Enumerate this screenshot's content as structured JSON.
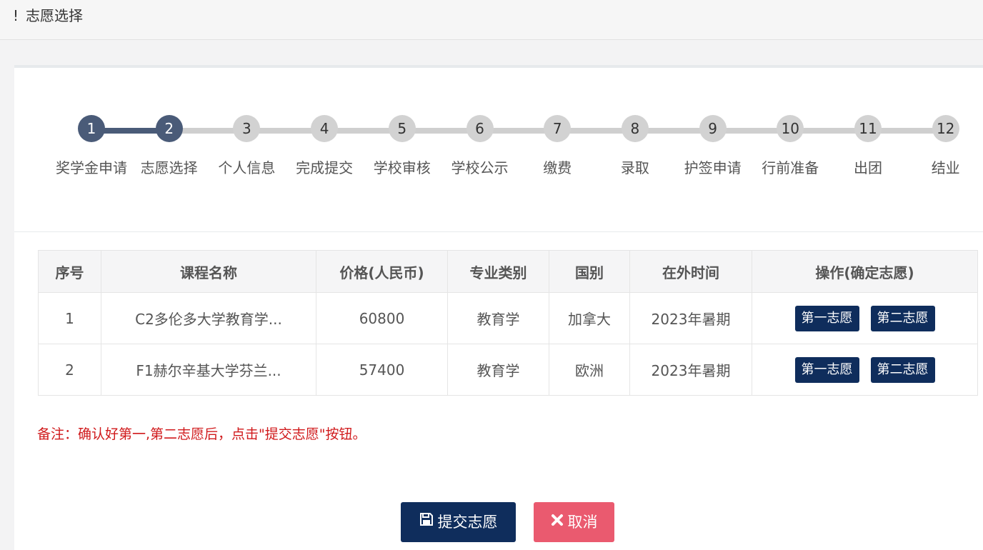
{
  "header": {
    "bang": "!",
    "title": "志愿选择"
  },
  "steps": [
    {
      "num": "1",
      "label": "奖学金申请",
      "done": true
    },
    {
      "num": "2",
      "label": "志愿选择",
      "done": true
    },
    {
      "num": "3",
      "label": "个人信息",
      "done": false
    },
    {
      "num": "4",
      "label": "完成提交",
      "done": false
    },
    {
      "num": "5",
      "label": "学校审核",
      "done": false
    },
    {
      "num": "6",
      "label": "学校公示",
      "done": false
    },
    {
      "num": "7",
      "label": "缴费",
      "done": false
    },
    {
      "num": "8",
      "label": "录取",
      "done": false
    },
    {
      "num": "9",
      "label": "护签申请",
      "done": false
    },
    {
      "num": "10",
      "label": "行前准备",
      "done": false
    },
    {
      "num": "11",
      "label": "出团",
      "done": false
    },
    {
      "num": "12",
      "label": "结业",
      "done": false
    }
  ],
  "table": {
    "headers": [
      "序号",
      "课程名称",
      "价格(人民币)",
      "专业类别",
      "国别",
      "在外时间",
      "操作(确定志愿)"
    ],
    "rows": [
      {
        "index": "1",
        "course": "C2多伦多大学教育学...",
        "price": "60800",
        "major": "教育学",
        "country": "加拿大",
        "time": "2023年暑期"
      },
      {
        "index": "2",
        "course": "F1赫尔辛基大学芬兰...",
        "price": "57400",
        "major": "教育学",
        "country": "欧洲",
        "time": "2023年暑期"
      }
    ],
    "first_choice_label": "第一志愿",
    "second_choice_label": "第二志愿"
  },
  "note": "备注：确认好第一,第二志愿后，点击\"提交志愿\"按钮。",
  "actions": {
    "submit_label": "提交志愿",
    "cancel_label": "取消"
  },
  "colors": {
    "navy": "#0f2d5c",
    "step_active": "#4a5b78",
    "cancel": "#ea5a6f",
    "note_red": "#d0191b"
  }
}
